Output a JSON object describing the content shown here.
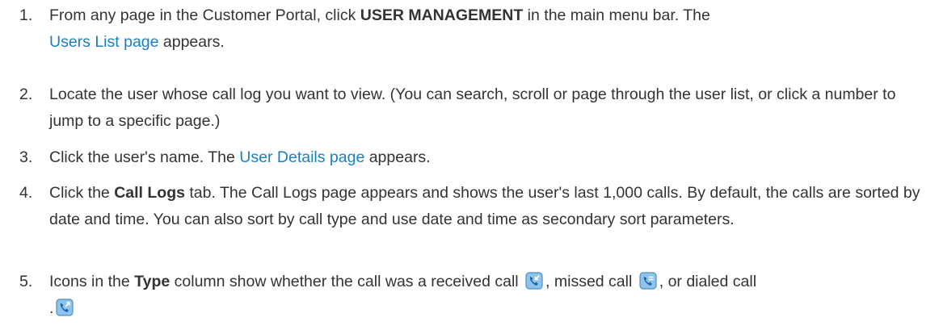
{
  "steps": [
    {
      "number": "1.",
      "t1": "From any page in the Customer Portal, click ",
      "bold": "USER MANAGEMENT",
      "t2": " in the main menu bar. The ",
      "link": "Users List page",
      "t3": " appears."
    },
    {
      "number": "2.",
      "text": "Locate the user whose call log you want to view. (You can search, scroll or page through the user list, or click a number to jump to a specific page.)"
    },
    {
      "number": "3.",
      "t1": "Click the user's name. The ",
      "link": "User Details page",
      "t2": " appears."
    },
    {
      "number": "4.",
      "t1": "Click the ",
      "bold": "Call Logs",
      "t2": " tab. The Call Logs page appears and shows the user's last 1,000 calls. By default, the calls are sorted by date and time. You can also sort by call type and use date and time as secondary sort parameters."
    },
    {
      "number": "5.",
      "t1": "Icons in the ",
      "bold": "Type",
      "t2": " column show whether the call was a received call ",
      "t3": ", missed call ",
      "t4": ", or dialed call ",
      "t5": "."
    }
  ],
  "icons": {
    "received": "received-call-icon",
    "missed": "missed-call-icon",
    "dialed": "dialed-call-icon"
  },
  "colors": {
    "text": "#333333",
    "link": "#1a7fbf",
    "icon_bg": "#8ec3ea",
    "icon_border": "#4f8fc4",
    "icon_handset": "#1e63a8"
  }
}
